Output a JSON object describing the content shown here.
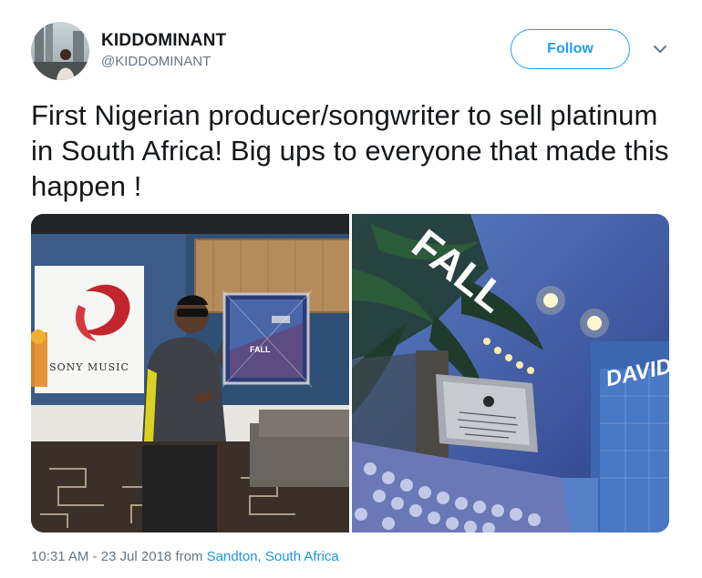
{
  "tweet": {
    "author": {
      "display_name": "KIDDOMINANT",
      "handle": "@KIDDOMINANT"
    },
    "follow_label": "Follow",
    "text": "First Nigerian producer/songwriter to sell platinum in South Africa! Big ups to everyone that made this happen !",
    "photos": [
      {
        "sign_text": "SONY MUSIC",
        "frame_text": "FALL"
      },
      {
        "poster_title": "FALL",
        "poster_artist": "DAVIDO"
      }
    ],
    "timestamp": "10:31 AM - 23 Jul 2018",
    "from_label": "from",
    "location": "Sandton, South Africa"
  },
  "colors": {
    "accent": "#1da1f2",
    "link": "#1b95e0",
    "secondary_text": "#657786",
    "primary_text": "#14171a"
  },
  "icons": {
    "menu": "chevron-down-icon"
  }
}
